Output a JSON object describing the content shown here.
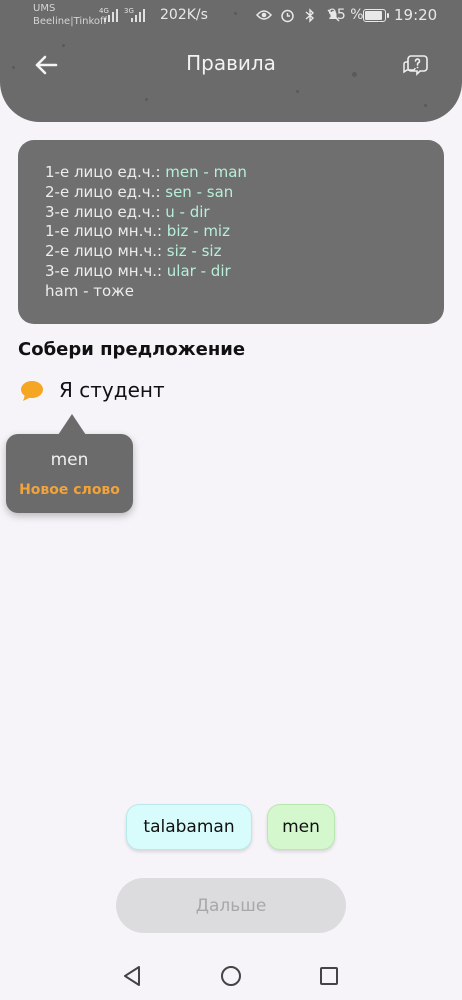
{
  "status_bar": {
    "carrier_1": "UMS",
    "carrier_2": "Beeline|Tinkoff",
    "net_1": "4G",
    "net_2": "3G",
    "speed": "202K/s",
    "battery": "95 %",
    "time": "19:20"
  },
  "header": {
    "title": "Правила",
    "back_icon": "arrow-left-icon",
    "help_icon": "help-chat-icon"
  },
  "rules": [
    {
      "label": "1-е лицо ед.ч.: ",
      "word": "men",
      "sep": " - ",
      "trans": "man"
    },
    {
      "label": "2-е лицо ед.ч.: ",
      "word": "sen",
      "sep": " - ",
      "trans": "san"
    },
    {
      "label": "3-е лицо ед.ч.: ",
      "word": "u",
      "sep": " - ",
      "trans": "dir"
    },
    {
      "label": "1-е лицо мн.ч.: ",
      "word": "biz",
      "sep": " - ",
      "trans": "miz"
    },
    {
      "label": "2-е лицо мн.ч.: ",
      "word": "siz",
      "sep": " - ",
      "trans": "siz"
    },
    {
      "label": "3-е лицо мн.ч.: ",
      "word": "ular",
      "sep": " - ",
      "trans": "dir"
    },
    {
      "label": "ham - тоже",
      "word": "",
      "sep": "",
      "trans": ""
    }
  ],
  "exercise": {
    "title": "Собери предложение",
    "sentence": "Я студент",
    "tooltip_word": "men",
    "tooltip_badge": "Новое слово"
  },
  "choices": [
    "talabaman",
    "men"
  ],
  "next_button": "Дальше",
  "colors": {
    "header_bg": "#6b6b6b",
    "card_bg": "#6f6f6f",
    "highlight": "#b8efd8",
    "new_word": "#f2a33a",
    "chip_1": "#d8fbfb",
    "chip_2": "#d4f7ce"
  }
}
